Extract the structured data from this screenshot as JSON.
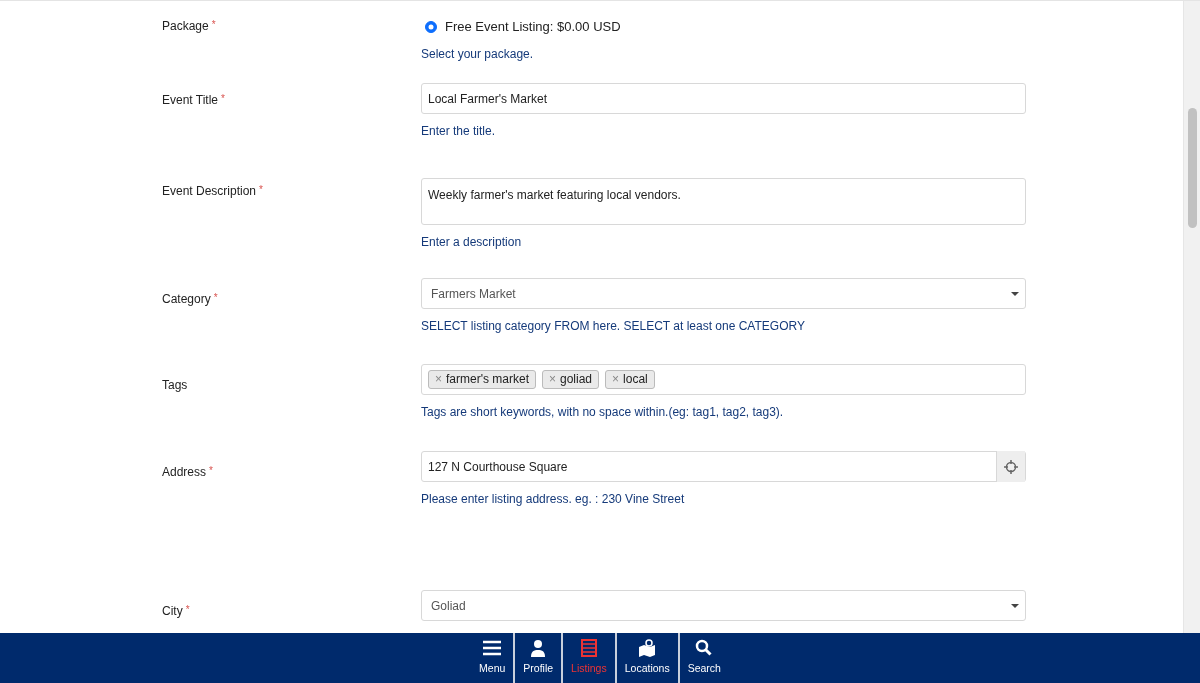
{
  "form": {
    "fields": [
      {
        "kind": "radio",
        "label": "Package",
        "required": true,
        "option": "Free Event Listing: $0.00 USD",
        "selected": true,
        "help": "Select your package."
      },
      {
        "kind": "text",
        "label": "Event Title",
        "required": true,
        "value": "Local Farmer's Market",
        "help": "Enter the title."
      },
      {
        "kind": "textarea",
        "label": "Event Description",
        "required": true,
        "value": "Weekly farmer's market featuring local vendors.",
        "help": "Enter a description"
      },
      {
        "kind": "select",
        "label": "Category",
        "required": true,
        "value": "Farmers Market",
        "help": "SELECT listing category FROM here. SELECT at least one CATEGORY"
      },
      {
        "kind": "tags",
        "label": "Tags",
        "required": false,
        "tags": [
          "farmer's market",
          "goliad",
          "local"
        ],
        "remove_glyph": "×",
        "help": "Tags are short keywords, with no space within.(eg: tag1, tag2, tag3)."
      },
      {
        "kind": "address",
        "label": "Address",
        "required": true,
        "value": "127 N Courthouse Square",
        "help": "Please enter listing address. eg. : 230 Vine Street"
      },
      {
        "kind": "select",
        "label": "City",
        "required": true,
        "value": "Goliad"
      }
    ],
    "required_mark": "*"
  },
  "bottom_nav": [
    {
      "label": "Menu",
      "kind": "menu",
      "selected": false
    },
    {
      "label": "Profile",
      "kind": "profile",
      "selected": false
    },
    {
      "label": "Listings",
      "kind": "listings",
      "selected": true
    },
    {
      "label": "Locations",
      "kind": "locations",
      "selected": false
    },
    {
      "label": "Search",
      "kind": "search",
      "selected": false
    }
  ]
}
